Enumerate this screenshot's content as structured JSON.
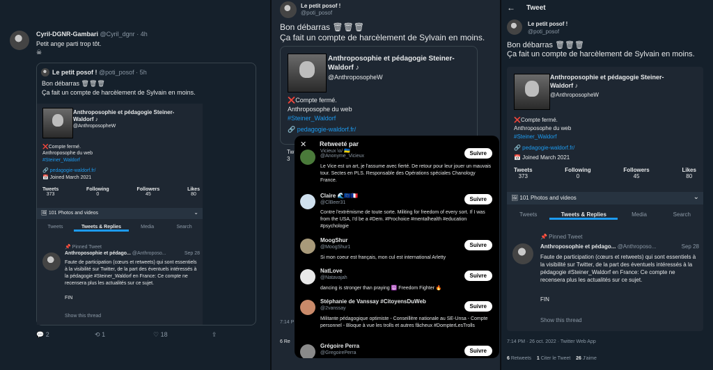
{
  "left": {
    "author_name": "Cyril-DGNR-Gambari",
    "author_handle": "@Cyril_dgnr",
    "time": "· 4h",
    "text": "Petit ange parti trop tôt.",
    "emoji": "☠",
    "quote": {
      "name": "Le petit posof !",
      "handle": "@poti_posof · 5h",
      "line1": "Bon débarras 🗑🗑🗑",
      "line2": "Ça fait un compte de harcèlement de Sylvain en moins."
    },
    "profile": {
      "title1": "Anthroposophie et pédagogie Steiner-",
      "title2": "Waldorf ♪",
      "handle": "@AnthroposopheW",
      "bio1": "❌Compte fermé.",
      "bio2": "Anthroposophe du web",
      "hashtag": "#Steiner_Waldorf",
      "url": "🔗 pedagogie-waldorf.fr/",
      "joined": "📅 Joined March 2021",
      "stats": [
        {
          "label": "Tweets",
          "value": "373"
        },
        {
          "label": "Following",
          "value": "0"
        },
        {
          "label": "Followers",
          "value": "45"
        },
        {
          "label": "Likes",
          "value": "80"
        }
      ],
      "photos": "🖼 101 Photos and videos",
      "tabs": [
        "Tweets",
        "Tweets & Replies",
        "Media",
        "Search"
      ],
      "pinned": "📌 Pinned Tweet",
      "pinned_name": "Anthroposophie et pédago...",
      "pinned_handle": "@Anthroposo...",
      "pinned_date": "Sep 28",
      "pinned_text": "Faute de participation (cœurs et retweets) qui sont essentiels à la visibilité sur Twitter, de la part des éventuels intéressés à la pédagogie #Steiner_Waldorf en France: Ce compte ne recensera plus les actualités sur ce sujet.",
      "fin": "FIN",
      "show_thread": "Show this thread"
    },
    "actions": {
      "reply": "2",
      "retweet": "1",
      "like": "18"
    }
  },
  "middle": {
    "author_name": "Le petit posof !",
    "author_handle": "@poti_posof",
    "line1": "Bon débarras 🗑🗑🗑",
    "line2": "Ça fait un compte de harcèlement de Sylvain en moins.",
    "card_title1": "Anthroposophie et pédagogie Steiner-",
    "card_title2": "Waldorf ♪",
    "card_handle": "@AnthroposopheW",
    "card_bio1": "❌Compte fermé.",
    "card_bio2": "Anthroposophe du web",
    "card_hashtag": "#Steiner_Waldorf",
    "card_url": "🔗 pedagogie-waldorf.fr/",
    "peek": [
      "Tw",
      "3",
      "7:14 P",
      "6 Re"
    ]
  },
  "modal": {
    "title": "Retweeté par",
    "follow_label": "Suivre",
    "users": [
      {
        "name": "Vicieux \\o/ 🇺🇦",
        "handle": "@Anonyme_Vicieux",
        "bio": "Le Vice est un art, je l'assume avec fierté. De retour pour leur jouer un mauvais tour. Sectes en PLS. Responsable des Opérations spéciales Chanology France."
      },
      {
        "name": "Claire 🌊🇪🇺🇫🇷",
        "handle": "@ClBeer31",
        "bio": "Contre l'extrémisme de toute sorte. Militing for freedom of every sort. If I was from the USA, I'd be a #Dem. #Prochoice #mentalhealth #education #psychologie"
      },
      {
        "name": "MoogShur",
        "handle": "@MoogShur1",
        "bio": "Si mon coeur est français, mon cul est international Arletty"
      },
      {
        "name": "NatLove",
        "handle": "@Natavajah",
        "bio": "dancing is stronger than praying ☮️ Freedom Fighter 🔥"
      },
      {
        "name": "Stéphanie de Vanssay #CitoyensDuWeb",
        "handle": "@2vanssay",
        "bio": "Militante pédagogique optimiste - Conseillère nationale au SE-Unsa - Compte personnel - Bloque à vue les trolls et autres fâcheux #DompterLesTrolls"
      },
      {
        "name": "Grégoire Perra",
        "handle": "@GregoirePerra",
        "bio": ""
      }
    ]
  },
  "right": {
    "header_title": "Tweet",
    "author_name": "Le petit posof !",
    "author_handle": "@poti_posof",
    "line1": "Bon débarras 🗑🗑🗑",
    "line2": "Ça fait un compte de harcèlement de Sylvain en moins.",
    "profile": {
      "title1": "Anthroposophie et pédagogie Steiner-",
      "title2": "Waldorf ♪",
      "handle": "@AnthroposopheW",
      "bio1": "❌Compte fermé.",
      "bio2": "Anthroposophe du web",
      "hashtag": "#Steiner_Waldorf",
      "url": "🔗 pedagogie-waldorf.fr/",
      "joined": "📅 Joined March 2021",
      "stats": [
        {
          "label": "Tweets",
          "value": "373"
        },
        {
          "label": "Following",
          "value": "0"
        },
        {
          "label": "Followers",
          "value": "45"
        },
        {
          "label": "Likes",
          "value": "80"
        }
      ],
      "photos": "🖼 101 Photos and videos",
      "tabs": [
        "Tweets",
        "Tweets & Replies",
        "Media",
        "Search"
      ],
      "pinned": "📌 Pinned Tweet",
      "pinned_name": "Anthroposophie et pédago...",
      "pinned_handle": "@Anthroposo...",
      "pinned_date": "Sep 28",
      "pinned_text": "Faute de participation (cœurs et retweets) qui sont essentiels à la visibilité sur Twitter, de la part des éventuels intéressés à la pédagogie #Steiner_Waldorf en France: Ce compte ne recensera plus les actualités sur ce sujet.",
      "fin": "FIN",
      "show_thread": "Show this thread"
    },
    "timestamp": "7:14 PM · 26 oct. 2022 · Twitter Web App",
    "stats": {
      "retweets": "6",
      "retweets_label": "Retweets",
      "quotes": "1",
      "quotes_label": "Citer le Tweet",
      "likes": "26",
      "likes_label": "J'aime"
    }
  }
}
